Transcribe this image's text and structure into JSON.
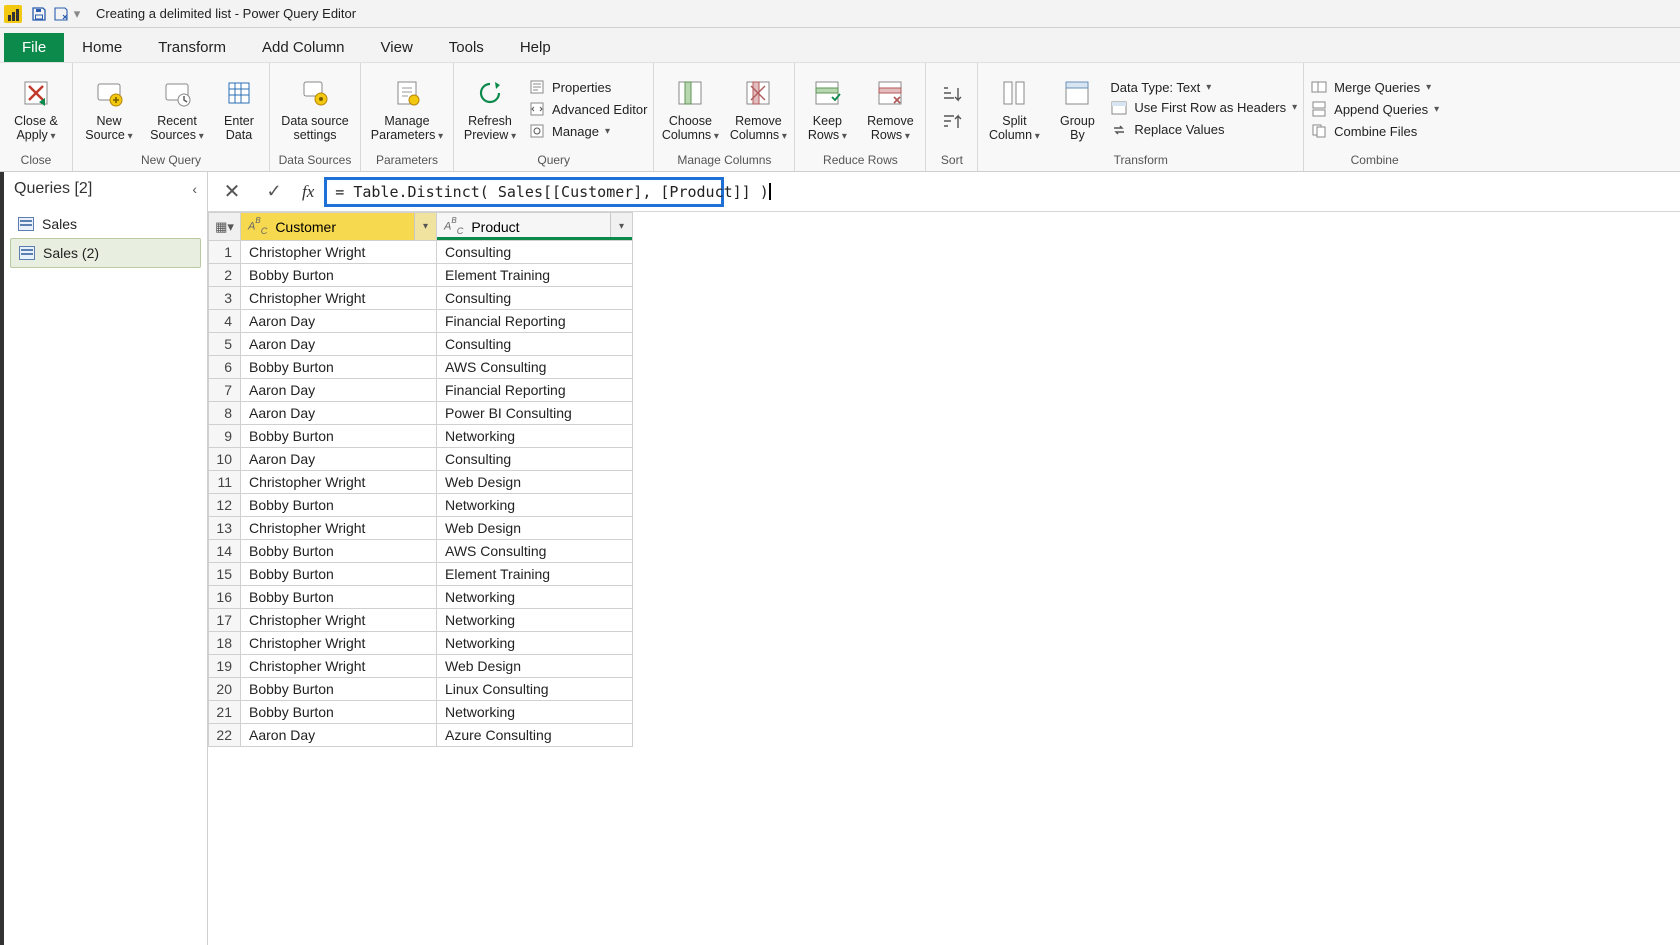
{
  "title": "Creating a delimited list - Power Query Editor",
  "menu": {
    "file": "File",
    "home": "Home",
    "transform": "Transform",
    "add_column": "Add Column",
    "view": "View",
    "tools": "Tools",
    "help": "Help"
  },
  "ribbon": {
    "close": {
      "close_apply": "Close &\nApply",
      "group": "Close"
    },
    "new_query": {
      "new_source": "New\nSource",
      "recent_sources": "Recent\nSources",
      "enter_data": "Enter\nData",
      "group": "New Query"
    },
    "data_sources": {
      "data_source_settings": "Data source\nsettings",
      "group": "Data Sources"
    },
    "parameters": {
      "manage_parameters": "Manage\nParameters",
      "group": "Parameters"
    },
    "query": {
      "refresh_preview": "Refresh\nPreview",
      "properties": "Properties",
      "advanced_editor": "Advanced Editor",
      "manage": "Manage",
      "group": "Query"
    },
    "manage_columns": {
      "choose_columns": "Choose\nColumns",
      "remove_columns": "Remove\nColumns",
      "group": "Manage Columns"
    },
    "reduce_rows": {
      "keep_rows": "Keep\nRows",
      "remove_rows": "Remove\nRows",
      "group": "Reduce Rows"
    },
    "sort": {
      "group": "Sort"
    },
    "transform": {
      "split_column": "Split\nColumn",
      "group_by": "Group\nBy",
      "data_type": "Data Type: Text",
      "first_row_headers": "Use First Row as Headers",
      "replace_values": "Replace Values",
      "group": "Transform"
    },
    "combine": {
      "merge_queries": "Merge Queries",
      "append_queries": "Append Queries",
      "combine_files": "Combine Files",
      "group": "Combine"
    }
  },
  "queries_pane": {
    "header": "Queries [2]",
    "items": [
      {
        "label": "Sales"
      },
      {
        "label": "Sales (2)"
      }
    ],
    "selected_index": 1
  },
  "formula_bar": {
    "value": "= Table.Distinct( Sales[[Customer], [Product]] )"
  },
  "grid": {
    "columns": [
      {
        "name": "Customer",
        "type": "ABC",
        "selected": true
      },
      {
        "name": "Product",
        "type": "ABC",
        "selected": false
      }
    ],
    "rows": [
      {
        "n": 1,
        "Customer": "Christopher Wright",
        "Product": "Consulting"
      },
      {
        "n": 2,
        "Customer": "Bobby Burton",
        "Product": "Element Training"
      },
      {
        "n": 3,
        "Customer": "Christopher Wright",
        "Product": "Consulting"
      },
      {
        "n": 4,
        "Customer": "Aaron Day",
        "Product": "Financial Reporting"
      },
      {
        "n": 5,
        "Customer": "Aaron Day",
        "Product": "Consulting"
      },
      {
        "n": 6,
        "Customer": "Bobby Burton",
        "Product": "AWS Consulting"
      },
      {
        "n": 7,
        "Customer": "Aaron Day",
        "Product": "Financial Reporting"
      },
      {
        "n": 8,
        "Customer": "Aaron Day",
        "Product": "Power BI Consulting"
      },
      {
        "n": 9,
        "Customer": "Bobby Burton",
        "Product": "Networking"
      },
      {
        "n": 10,
        "Customer": "Aaron Day",
        "Product": "Consulting"
      },
      {
        "n": 11,
        "Customer": "Christopher Wright",
        "Product": "Web Design"
      },
      {
        "n": 12,
        "Customer": "Bobby Burton",
        "Product": "Networking"
      },
      {
        "n": 13,
        "Customer": "Christopher Wright",
        "Product": "Web Design"
      },
      {
        "n": 14,
        "Customer": "Bobby Burton",
        "Product": "AWS Consulting"
      },
      {
        "n": 15,
        "Customer": "Bobby Burton",
        "Product": "Element Training"
      },
      {
        "n": 16,
        "Customer": "Bobby Burton",
        "Product": "Networking"
      },
      {
        "n": 17,
        "Customer": "Christopher Wright",
        "Product": "Networking"
      },
      {
        "n": 18,
        "Customer": "Christopher Wright",
        "Product": "Networking"
      },
      {
        "n": 19,
        "Customer": "Christopher Wright",
        "Product": "Web Design"
      },
      {
        "n": 20,
        "Customer": "Bobby Burton",
        "Product": "Linux Consulting"
      },
      {
        "n": 21,
        "Customer": "Bobby Burton",
        "Product": "Networking"
      },
      {
        "n": 22,
        "Customer": "Aaron Day",
        "Product": "Azure Consulting"
      }
    ]
  }
}
